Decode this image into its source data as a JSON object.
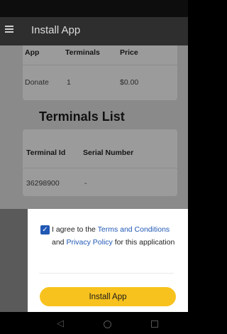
{
  "appbar": {
    "title": "Install App"
  },
  "apps_table": {
    "headers": [
      "App",
      "Terminals",
      "Price"
    ],
    "rows": [
      [
        "Donate",
        "1",
        "$0.00"
      ]
    ]
  },
  "terminals": {
    "section_title": "Terminals List",
    "headers": [
      "Terminal Id",
      "Serial Number"
    ],
    "rows": [
      [
        "36298900",
        "-"
      ]
    ]
  },
  "consent": {
    "checked": true,
    "text_1": "I agree to the ",
    "terms_link": "Terms and Conditions",
    "text_2": " and ",
    "privacy_link": "Privacy Policy",
    "text_3": " for this application"
  },
  "install_button": "Install App",
  "colors": {
    "accent": "#f8c21e",
    "link": "#2158b4",
    "appbar": "#2e2e2e"
  },
  "icons": {
    "menu": "hamburger-menu-icon",
    "back": "nav-back-icon",
    "home": "nav-home-icon",
    "recent": "nav-recent-icon"
  }
}
